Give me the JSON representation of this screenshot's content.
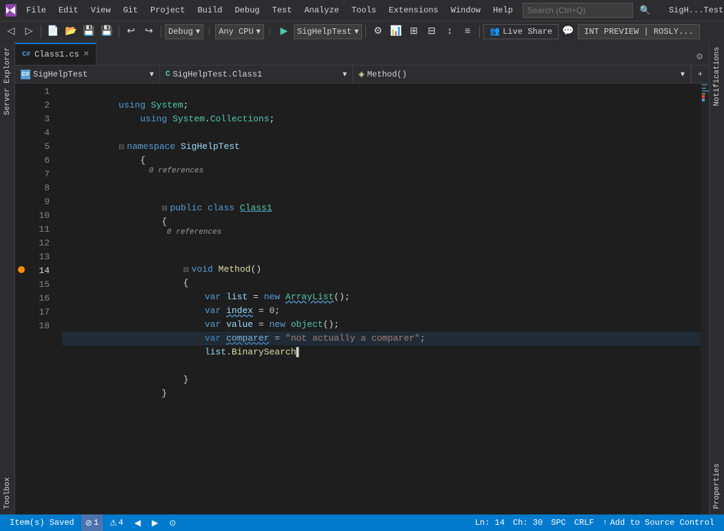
{
  "titleBar": {
    "logo": "VS",
    "menus": [
      "File",
      "Edit",
      "View",
      "Git",
      "Project",
      "Build",
      "Debug",
      "Test",
      "Analyze",
      "Tools",
      "Extensions",
      "Window",
      "Help"
    ],
    "searchPlaceholder": "Search (Ctrl+Q)",
    "windowTitle": "SigH...Test",
    "minimize": "—",
    "maximize": "□",
    "close": "✕"
  },
  "toolbar": {
    "debugConfig": "Debug",
    "platform": "Any CPU",
    "runTarget": "SigHelpTest",
    "liveshare": "Live Share",
    "intPreview": "INT PREVIEW | ROSLY..."
  },
  "tabBar": {
    "activeTab": "Class1.cs",
    "activeTabIcon": "C#",
    "closeIcon": "×",
    "settingsIcon": "⚙"
  },
  "navBar": {
    "namespace": "SigHelpTest",
    "nsIcon": "C#",
    "classPath": "SigHelpTest.Class1",
    "classIcon": "C",
    "method": "Method()",
    "methodIcon": "m",
    "addIcon": "+"
  },
  "code": {
    "lines": [
      {
        "num": 1,
        "indent": 0,
        "content": "using System;",
        "type": "using"
      },
      {
        "num": 2,
        "indent": 1,
        "content": "using System.Collections;",
        "type": "using"
      },
      {
        "num": 3,
        "indent": 0,
        "content": "",
        "type": "blank"
      },
      {
        "num": 4,
        "indent": 0,
        "content": "namespace SigHelpTest",
        "type": "namespace"
      },
      {
        "num": 5,
        "indent": 0,
        "content": "{",
        "type": "brace"
      },
      {
        "num": 6,
        "indent": 1,
        "content": "public class Class1",
        "type": "class"
      },
      {
        "num": 7,
        "indent": 1,
        "content": "{",
        "type": "brace"
      },
      {
        "num": 8,
        "indent": 2,
        "content": "void Method()",
        "type": "method"
      },
      {
        "num": 9,
        "indent": 2,
        "content": "{",
        "type": "brace"
      },
      {
        "num": 10,
        "indent": 3,
        "content": "var list = new ArrayList();",
        "type": "code"
      },
      {
        "num": 11,
        "indent": 3,
        "content": "var index = 0;",
        "type": "code"
      },
      {
        "num": 12,
        "indent": 3,
        "content": "var value = new object();",
        "type": "code"
      },
      {
        "num": 13,
        "indent": 3,
        "content": "var comparer = \"not actually a comparer\";",
        "type": "code"
      },
      {
        "num": 14,
        "indent": 3,
        "content": "list.BinarySearch",
        "type": "code_active"
      },
      {
        "num": 15,
        "indent": 0,
        "content": "",
        "type": "blank"
      },
      {
        "num": 16,
        "indent": 2,
        "content": "}",
        "type": "brace"
      },
      {
        "num": 17,
        "indent": 1,
        "content": "}",
        "type": "brace"
      },
      {
        "num": 18,
        "indent": 0,
        "content": "",
        "type": "blank"
      }
    ]
  },
  "statusBar": {
    "saved": "Item(s) Saved",
    "errors": "1",
    "warnings": "4",
    "navBack": "◀",
    "navForward": "▶",
    "line": "Ln: 14",
    "char": "Ch: 30",
    "space": "SPC",
    "lineEnding": "CRLF",
    "addToSourceControl": "Add to Source Control",
    "upArrow": "↑"
  }
}
